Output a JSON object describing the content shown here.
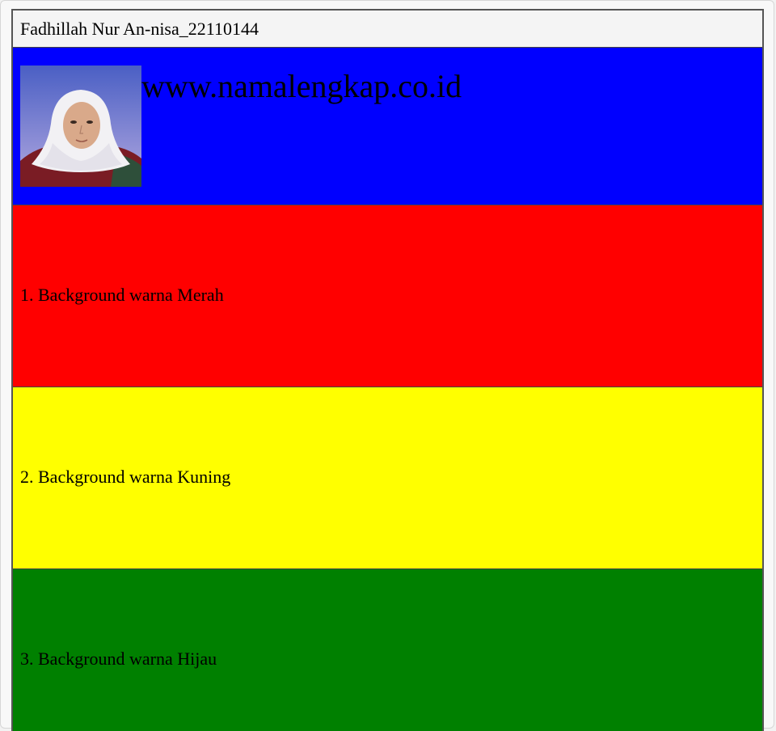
{
  "title": "Fadhillah Nur An-nisa_22110144",
  "header": {
    "site_url": "www.namalengkap.co.id",
    "background": "#0000ff"
  },
  "rows": [
    {
      "label": "1. Background warna Merah",
      "color": "#ff0000"
    },
    {
      "label": "2. Background warna Kuning",
      "color": "#ffff00"
    },
    {
      "label": "3. Background warna Hijau",
      "color": "#008000"
    }
  ]
}
